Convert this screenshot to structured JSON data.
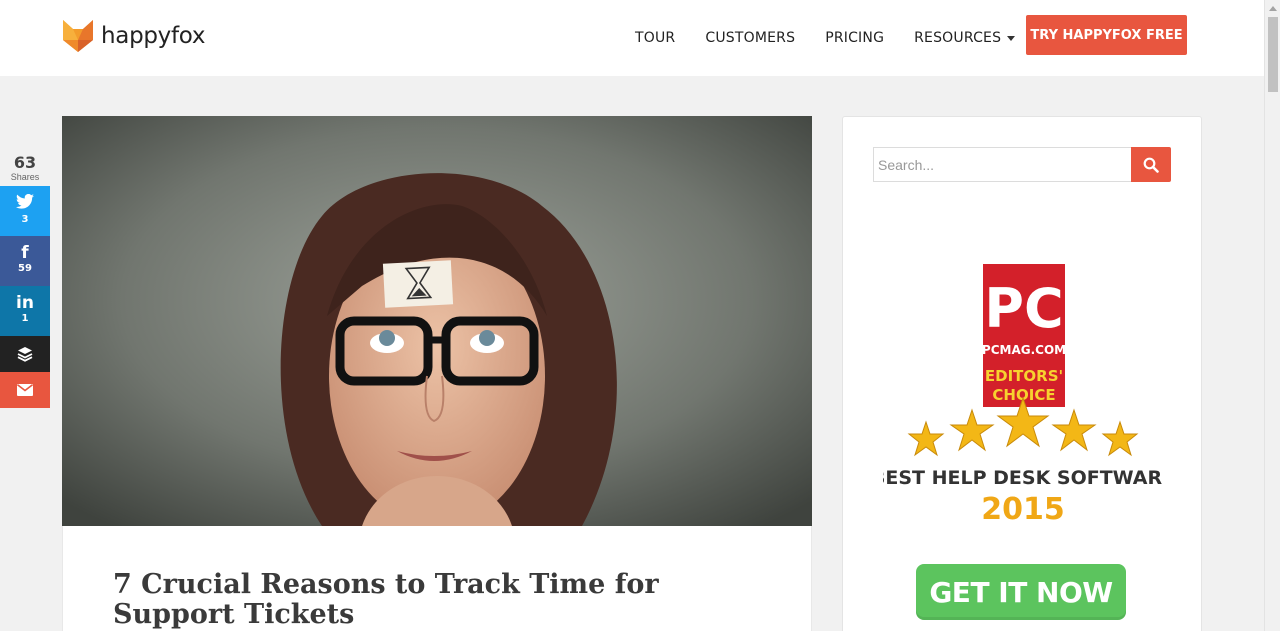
{
  "header": {
    "logo_text": "happyfox",
    "nav": [
      {
        "label": "TOUR"
      },
      {
        "label": "CUSTOMERS"
      },
      {
        "label": "PRICING"
      },
      {
        "label": "RESOURCES"
      }
    ],
    "cta_label": "TRY HAPPYFOX FREE"
  },
  "share": {
    "total": "63",
    "total_label": "Shares",
    "buttons": [
      {
        "network": "twitter",
        "icon": "twitter-icon",
        "count": "3",
        "color": "#1da1f2"
      },
      {
        "network": "facebook",
        "icon": "facebook-icon",
        "count": "59",
        "color": "#3b5998"
      },
      {
        "network": "linkedin",
        "icon": "linkedin-icon",
        "count": "1",
        "color": "#0e76a8"
      },
      {
        "network": "buffer",
        "icon": "buffer-icon",
        "count": "",
        "color": "#222222"
      },
      {
        "network": "email",
        "icon": "email-icon",
        "count": "",
        "color": "#e8563f"
      }
    ]
  },
  "article": {
    "title": "7 Crucial Reasons to Track Time for Support Tickets"
  },
  "sidebar": {
    "search_placeholder": "Search...",
    "award": {
      "logo": "PC",
      "site": "PCMAG.COM",
      "badge_line1": "EDITORS'",
      "badge_line2": "CHOICE",
      "headline": "BEST HELP DESK SOFTWARE",
      "year": "2015",
      "stars": 5
    },
    "cta_label": "GET IT NOW"
  },
  "colors": {
    "brand_orange": "#e8563f",
    "cta_green": "#5cc45e",
    "pcmag_red": "#d3202a",
    "star_gold": "#f3b716"
  }
}
